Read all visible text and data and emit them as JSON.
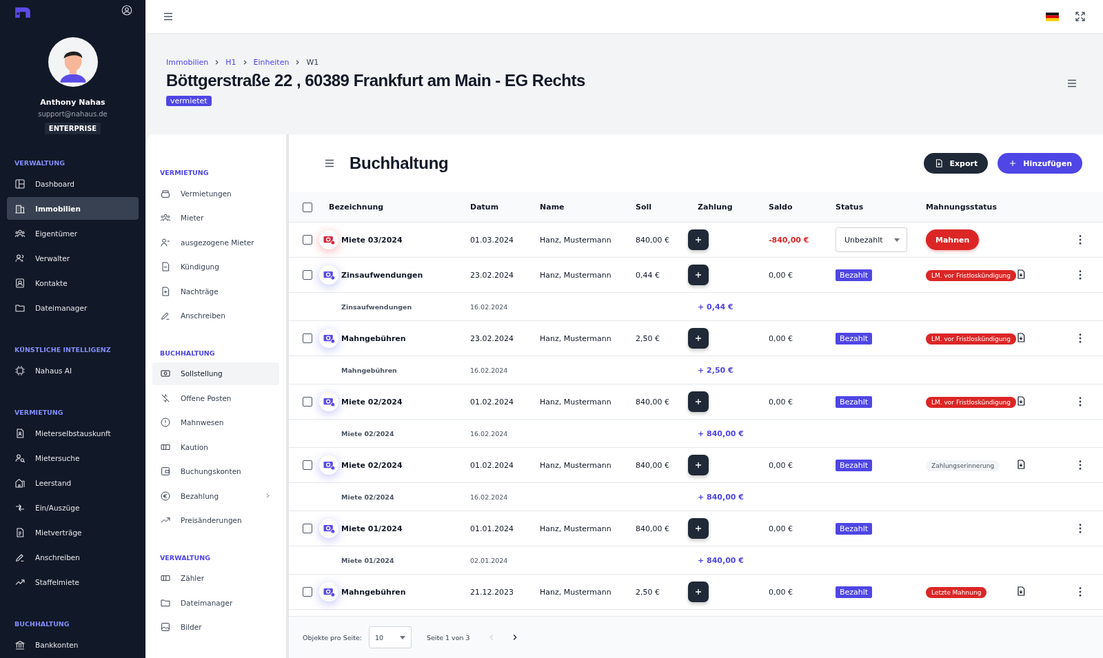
{
  "user": {
    "name": "Anthony Nahas",
    "email": "support@nahaus.de",
    "plan": "ENTERPRISE"
  },
  "sidebar": {
    "sections": [
      {
        "title": "VERWALTUNG",
        "items": [
          {
            "label": "Dashboard",
            "selected": false
          },
          {
            "label": "Immobilien",
            "selected": true
          },
          {
            "label": "Eigentümer",
            "selected": false
          },
          {
            "label": "Verwalter",
            "selected": false
          },
          {
            "label": "Kontakte",
            "selected": false
          },
          {
            "label": "Dateimanager",
            "selected": false
          }
        ]
      },
      {
        "title": "KÜNSTLICHE INTELLIGENZ",
        "items": [
          {
            "label": "Nahaus AI",
            "selected": false
          }
        ]
      },
      {
        "title": "VERMIETUNG",
        "items": [
          {
            "label": "Mieterselbstauskunft",
            "selected": false
          },
          {
            "label": "Mietersuche",
            "selected": false
          },
          {
            "label": "Leerstand",
            "selected": false
          },
          {
            "label": "Ein/Auszüge",
            "selected": false
          },
          {
            "label": "Mietverträge",
            "selected": false
          },
          {
            "label": "Anschreiben",
            "selected": false
          },
          {
            "label": "Staffelmiete",
            "selected": false
          }
        ]
      },
      {
        "title": "BUCHHALTUNG",
        "items": [
          {
            "label": "Bankkonten",
            "selected": false
          }
        ]
      }
    ]
  },
  "breadcrumbs": [
    "Immobilien",
    "H1",
    "Einheiten",
    "W1"
  ],
  "page_title": "Böttgerstraße 22 , 60389 Frankfurt am Main - EG Rechts",
  "unit_status": "vermietet",
  "submenu": {
    "sections": [
      {
        "title": "VERMIETUNG",
        "items": [
          {
            "label": "Vermietungen",
            "selected": false,
            "has_children": false
          },
          {
            "label": "Mieter",
            "selected": false,
            "has_children": false
          },
          {
            "label": "ausgezogene Mieter",
            "selected": false,
            "has_children": false
          },
          {
            "label": "Kündigung",
            "selected": false,
            "has_children": false
          },
          {
            "label": "Nachträge",
            "selected": false,
            "has_children": false
          },
          {
            "label": "Anschreiben",
            "selected": false,
            "has_children": false
          }
        ]
      },
      {
        "title": "BUCHHALTUNG",
        "items": [
          {
            "label": "Sollstellung",
            "selected": true,
            "has_children": false
          },
          {
            "label": "Offene Posten",
            "selected": false,
            "has_children": false
          },
          {
            "label": "Mahnwesen",
            "selected": false,
            "has_children": false
          },
          {
            "label": "Kaution",
            "selected": false,
            "has_children": false
          },
          {
            "label": "Buchungskonten",
            "selected": false,
            "has_children": false
          },
          {
            "label": "Bezahlung",
            "selected": false,
            "has_children": true
          },
          {
            "label": "Preisänderungen",
            "selected": false,
            "has_children": false
          }
        ]
      },
      {
        "title": "VERWALTUNG",
        "items": [
          {
            "label": "Zähler",
            "selected": false,
            "has_children": false
          },
          {
            "label": "Dateimanager",
            "selected": false,
            "has_children": false
          },
          {
            "label": "Bilder",
            "selected": false,
            "has_children": false
          }
        ]
      }
    ]
  },
  "panel": {
    "title": "Buchhaltung",
    "export_button": "Export",
    "add_button": "Hinzufügen"
  },
  "table": {
    "select_all_checked": false,
    "columns": [
      "Bezeichnung",
      "Datum",
      "Name",
      "Soll",
      "Zahlung",
      "Saldo",
      "Status",
      "Mahnungsstatus"
    ],
    "rows": [
      {
        "kind": "entry",
        "checked": false,
        "overdue": true,
        "label": "Miete 03/2024",
        "date": "01.03.2024",
        "name": "Hanz, Mustermann",
        "soll": "840,00 €",
        "saldo": "-840,00 €",
        "status": {
          "kind": "dropdown",
          "text": "Unbezahlt"
        },
        "reminder": {
          "kind": "button",
          "text": "Mahnen"
        },
        "has_document": false
      },
      {
        "kind": "entry",
        "checked": false,
        "overdue": false,
        "label": "Zinsaufwendungen",
        "date": "23.02.2024",
        "name": "Hanz, Mustermann",
        "soll": "0,44 €",
        "saldo": "0,00 €",
        "status": {
          "kind": "badge",
          "text": "Bezahlt"
        },
        "reminder": {
          "kind": "danger",
          "text": "LM. vor Fristloskündigung"
        },
        "has_document": true
      },
      {
        "kind": "payment",
        "label": "Zinsaufwendungen",
        "date": "16.02.2024",
        "amount": "+ 0,44 €"
      },
      {
        "kind": "entry",
        "checked": false,
        "overdue": false,
        "label": "Mahngebühren",
        "date": "23.02.2024",
        "name": "Hanz, Mustermann",
        "soll": "2,50 €",
        "saldo": "0,00 €",
        "status": {
          "kind": "badge",
          "text": "Bezahlt"
        },
        "reminder": {
          "kind": "danger",
          "text": "LM. vor Fristloskündigung"
        },
        "has_document": true
      },
      {
        "kind": "payment",
        "label": "Mahngebühren",
        "date": "16.02.2024",
        "amount": "+ 2,50 €"
      },
      {
        "kind": "entry",
        "checked": false,
        "overdue": false,
        "label": "Miete 02/2024",
        "date": "01.02.2024",
        "name": "Hanz, Mustermann",
        "soll": "840,00 €",
        "saldo": "0,00 €",
        "status": {
          "kind": "badge",
          "text": "Bezahlt"
        },
        "reminder": {
          "kind": "danger",
          "text": "LM. vor Fristloskündigung"
        },
        "has_document": true
      },
      {
        "kind": "payment",
        "label": "Miete 02/2024",
        "date": "16.02.2024",
        "amount": "+ 840,00 €"
      },
      {
        "kind": "entry",
        "checked": false,
        "overdue": false,
        "label": "Miete 02/2024",
        "date": "01.02.2024",
        "name": "Hanz, Mustermann",
        "soll": "840,00 €",
        "saldo": "0,00 €",
        "status": {
          "kind": "badge",
          "text": "Bezahlt"
        },
        "reminder": {
          "kind": "neutral",
          "text": "Zahlungserinnerung"
        },
        "has_document": true
      },
      {
        "kind": "payment",
        "label": "Miete 02/2024",
        "date": "16.02.2024",
        "amount": "+ 840,00 €"
      },
      {
        "kind": "entry",
        "checked": false,
        "overdue": false,
        "label": "Miete 01/2024",
        "date": "01.01.2024",
        "name": "Hanz, Mustermann",
        "soll": "840,00 €",
        "saldo": "0,00 €",
        "status": {
          "kind": "badge",
          "text": "Bezahlt"
        },
        "reminder": {
          "kind": "none"
        },
        "has_document": false
      },
      {
        "kind": "payment",
        "label": "Miete 01/2024",
        "date": "02.01.2024",
        "amount": "+ 840,00 €"
      },
      {
        "kind": "entry",
        "checked": false,
        "overdue": false,
        "label": "Mahngebühren",
        "date": "21.12.2023",
        "name": "Hanz, Mustermann",
        "soll": "2,50 €",
        "saldo": "0,00 €",
        "status": {
          "kind": "badge",
          "text": "Bezahlt"
        },
        "reminder": {
          "kind": "danger",
          "text": "Letzte Mahnung"
        },
        "has_document": true
      }
    ]
  },
  "pagination": {
    "per_page_label": "Objekte pro Seite:",
    "per_page": "10",
    "page_info": "Seite 1 von 3",
    "prev_disabled": true,
    "next_disabled": false
  }
}
